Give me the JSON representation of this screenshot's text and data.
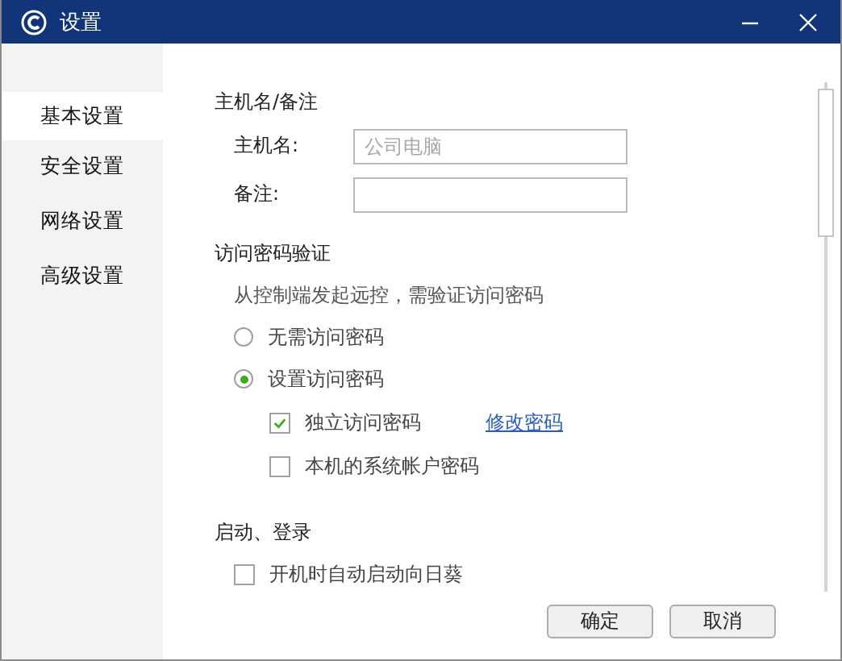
{
  "window": {
    "title": "设置"
  },
  "sidebar": {
    "items": [
      {
        "label": "基本设置",
        "selected": true
      },
      {
        "label": "安全设置",
        "selected": false
      },
      {
        "label": "网络设置",
        "selected": false
      },
      {
        "label": "高级设置",
        "selected": false
      }
    ]
  },
  "host_section": {
    "heading": "主机名/备注",
    "fields": [
      {
        "label": "主机名:",
        "placeholder": "公司电脑"
      },
      {
        "label": "备注:"
      }
    ]
  },
  "password_section": {
    "heading": "访问密码验证",
    "description": "从控制端发起远控，需验证访问密码",
    "options": [
      {
        "kind": "radio",
        "label": "无需访问密码",
        "selected": false
      },
      {
        "kind": "radio",
        "label": "设置访问密码",
        "selected": true,
        "children": [
          {
            "kind": "checkbox",
            "label": "独立访问密码",
            "checked": true,
            "link": "修改密码"
          },
          {
            "kind": "checkbox",
            "label": "本机的系统帐户密码",
            "checked": false
          }
        ]
      }
    ]
  },
  "startup_section": {
    "heading": "启动、登录",
    "options": [
      {
        "kind": "checkbox",
        "label": "开机时自动启动向日葵",
        "checked": false
      }
    ]
  },
  "buttons": [
    "确定",
    "取消"
  ]
}
